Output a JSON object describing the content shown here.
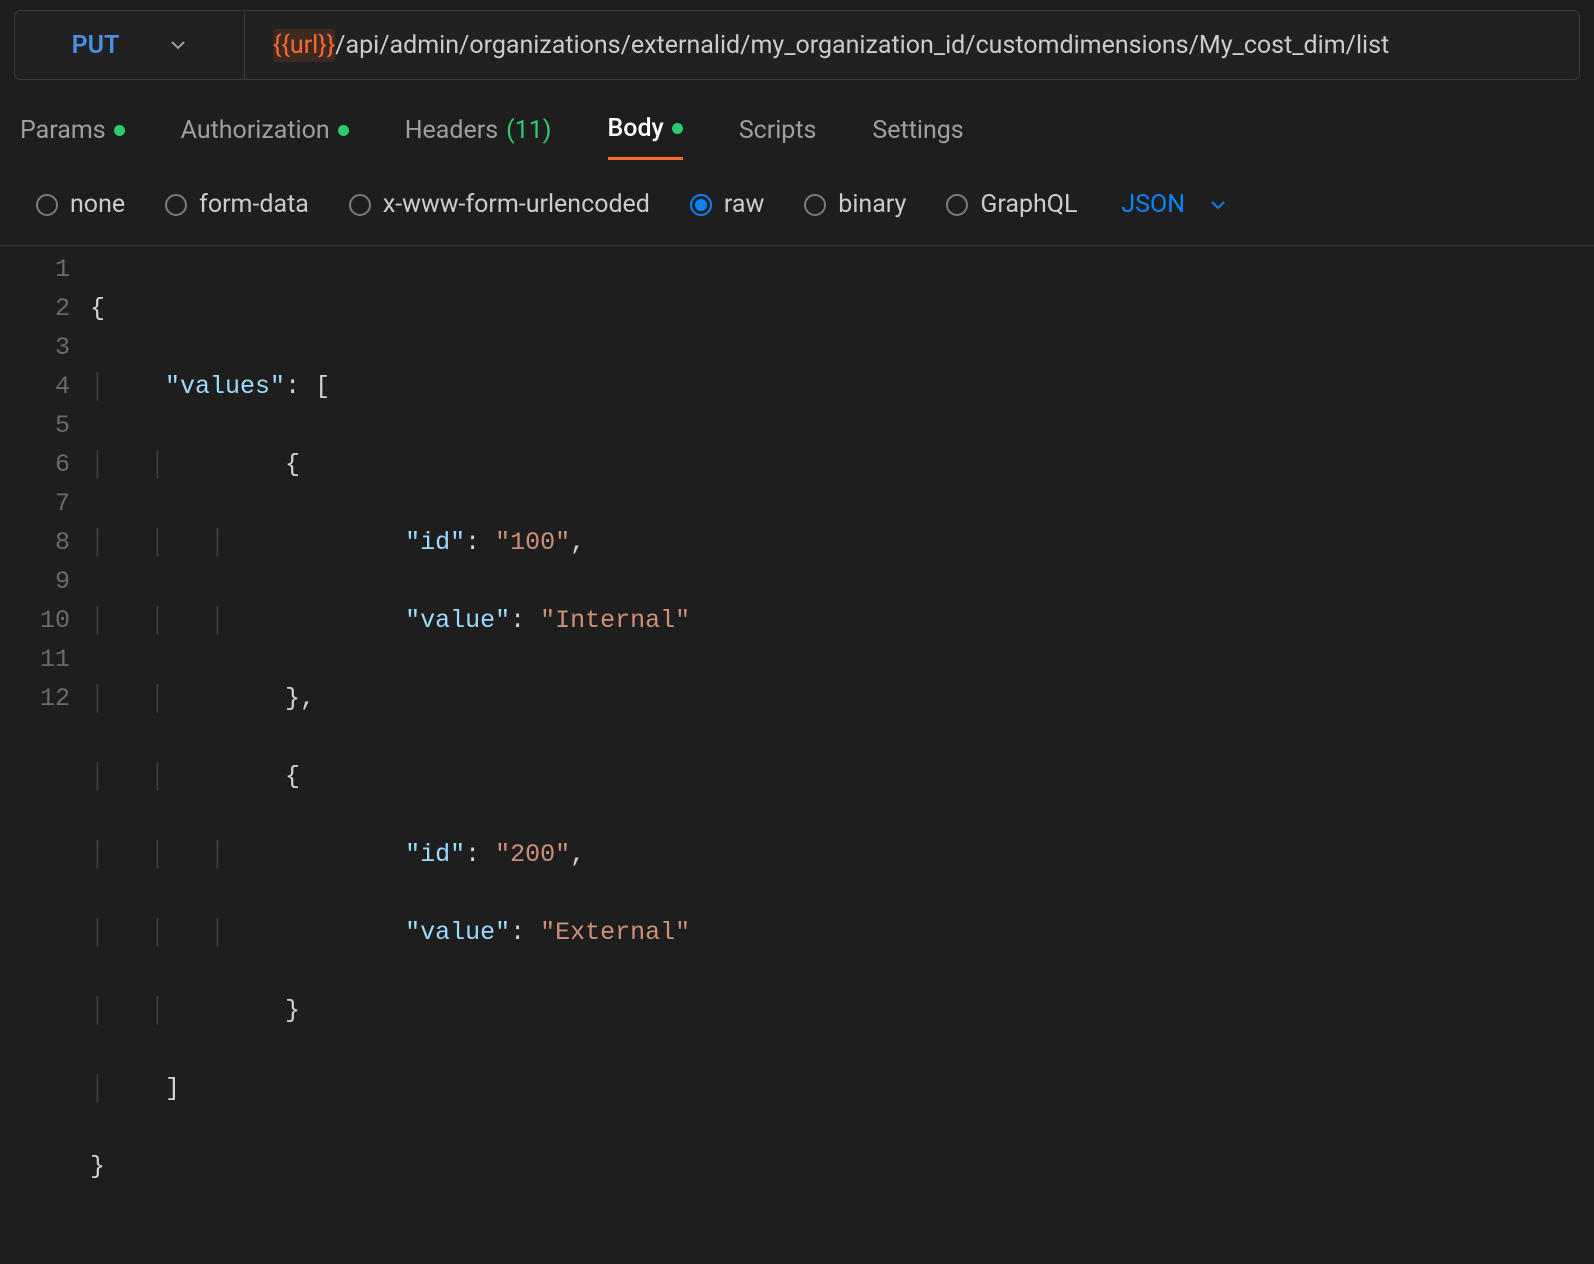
{
  "method": "PUT",
  "url": {
    "variable": "{{url}}",
    "path": " /api/admin/organizations/externalid/my_organization_id/customdimensions/My_cost_dim/list"
  },
  "tabs": {
    "params": {
      "label": "Params",
      "has_dot": true
    },
    "authorization": {
      "label": "Authorization",
      "has_dot": true
    },
    "headers": {
      "label": "Headers",
      "count": "(11)"
    },
    "body": {
      "label": "Body",
      "has_dot": true,
      "active": true
    },
    "scripts": {
      "label": "Scripts"
    },
    "settings": {
      "label": "Settings"
    }
  },
  "body_types": {
    "none": "none",
    "formdata": "form-data",
    "xwww": "x-www-form-urlencoded",
    "raw": "raw",
    "binary": "binary",
    "graphql": "GraphQL"
  },
  "language": "JSON",
  "code": {
    "l1": "{",
    "l2a": "    ",
    "l2k": "\"values\"",
    "l2b": ": [",
    "l3a": "        ",
    "l3b": "{",
    "l4a": "            ",
    "l4k": "\"id\"",
    "l4b": ": ",
    "l4s": "\"100\"",
    "l4c": ",",
    "l5a": "            ",
    "l5k": "\"value\"",
    "l5b": ": ",
    "l5s": "\"Internal\"",
    "l6a": "        ",
    "l6b": "},",
    "l7a": "        ",
    "l7b": "{",
    "l8a": "            ",
    "l8k": "\"id\"",
    "l8b": ": ",
    "l8s": "\"200\"",
    "l8c": ",",
    "l9a": "            ",
    "l9k": "\"value\"",
    "l9b": ": ",
    "l9s": "\"External\"",
    "l10a": "        ",
    "l10b": "}",
    "l11a": "    ",
    "l11b": "]",
    "l12": "}"
  },
  "line_numbers": [
    "1",
    "2",
    "3",
    "4",
    "5",
    "6",
    "7",
    "8",
    "9",
    "10",
    "11",
    "12"
  ]
}
